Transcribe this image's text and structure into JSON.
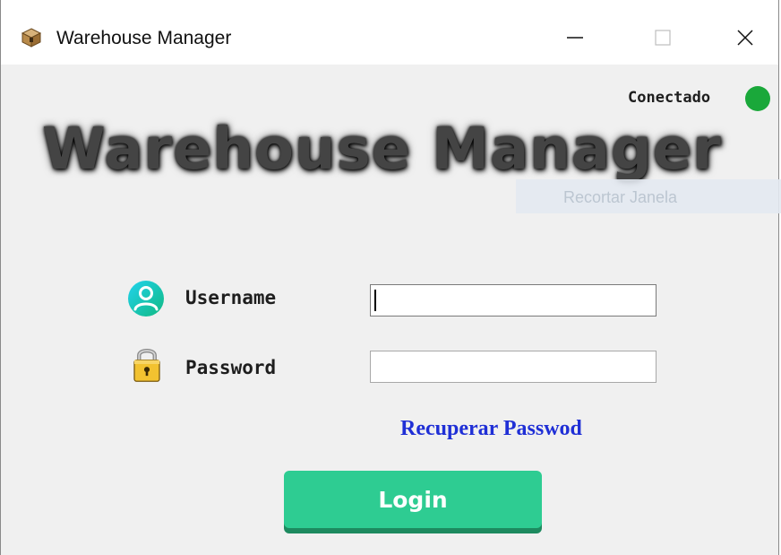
{
  "window": {
    "title": "Warehouse Manager",
    "controls": {
      "minimize": "minimize",
      "maximize": "maximize",
      "close": "close"
    }
  },
  "status": {
    "label": "Conectado",
    "color": "#1aa83a"
  },
  "banner": {
    "text": "Warehouse Manager"
  },
  "overlay": {
    "text": "Recortar Janela"
  },
  "form": {
    "username_label": "Username",
    "username_value": "",
    "password_label": "Password",
    "password_value": "",
    "recover_link": "Recuperar Passwod",
    "login_button": "Login"
  },
  "colors": {
    "accent": "#2ecc92",
    "link": "#1f2fd6",
    "status": "#1aa83a"
  },
  "icons": {
    "app": "package-icon",
    "user": "user-icon",
    "lock": "lock-icon"
  }
}
